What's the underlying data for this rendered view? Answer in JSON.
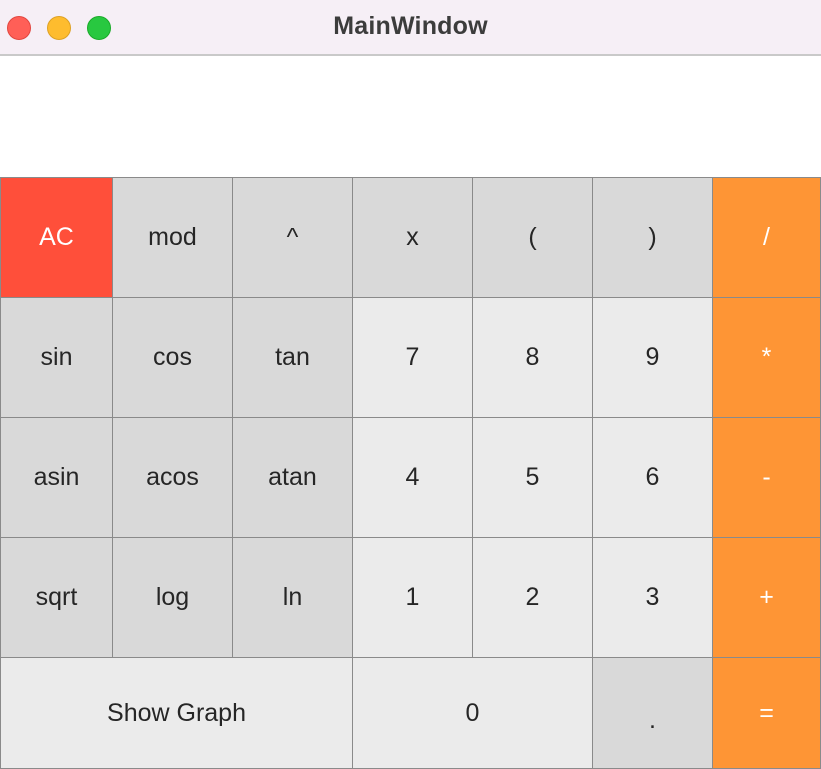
{
  "window": {
    "title": "MainWindow"
  },
  "display": {
    "value": ""
  },
  "keys": {
    "ac": "AC",
    "mod": "mod",
    "pow": "^",
    "x": "x",
    "lparen": "(",
    "rparen": ")",
    "div": "/",
    "sin": "sin",
    "cos": "cos",
    "tan": "tan",
    "n7": "7",
    "n8": "8",
    "n9": "9",
    "mul": "*",
    "asin": "asin",
    "acos": "acos",
    "atan": "atan",
    "n4": "4",
    "n5": "5",
    "n6": "6",
    "sub": "-",
    "sqrt": "sqrt",
    "log": "log",
    "ln": "ln",
    "n1": "1",
    "n2": "2",
    "n3": "3",
    "add": "+",
    "show_graph": "Show Graph",
    "n0": "0",
    "dot": ".",
    "eq": "="
  },
  "colors": {
    "function_key": "#d9d9d9",
    "digit_key": "#ebebeb",
    "operator_key": "#fe9535",
    "clear_key": "#ff4f3a",
    "titlebar": "#f6eff6"
  }
}
